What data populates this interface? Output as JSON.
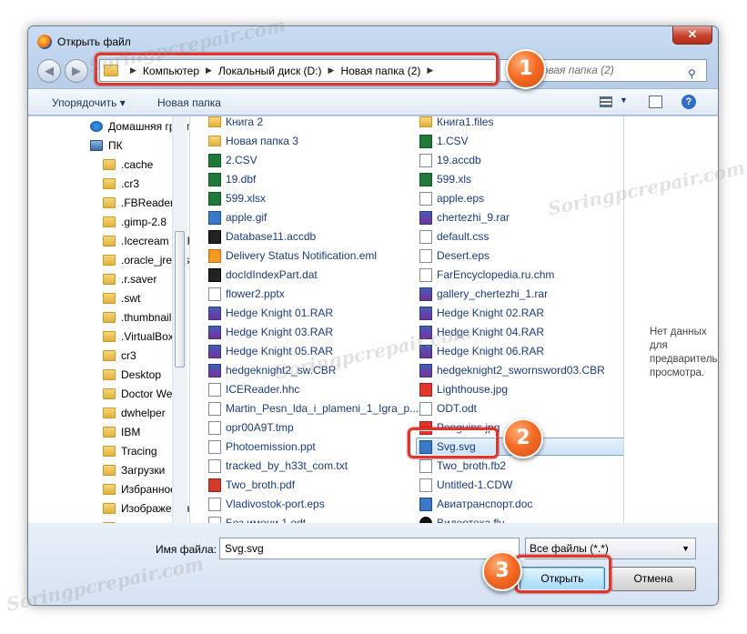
{
  "window": {
    "title": "Открыть файл",
    "close_symbol": "✕"
  },
  "nav": {
    "back": "◀",
    "forward": "▶"
  },
  "address": {
    "parts": [
      "Компьютер",
      "Локальный диск (D:)",
      "Новая папка (2)"
    ]
  },
  "search": {
    "placeholder": "Поиск: Новая папка (2)",
    "text": "иск: Новая папка (2)"
  },
  "toolbar": {
    "organize": "Упорядочить ▾",
    "new_folder": "Новая папка"
  },
  "tree": [
    {
      "label": "Домашняя группа",
      "icon": "homegroup-icon"
    },
    {
      "label": "ПК",
      "icon": "computer-icon"
    },
    {
      "label": ".cache",
      "icon": "folder-icon"
    },
    {
      "label": ".cr3",
      "icon": "folder-icon"
    },
    {
      "label": ".FBReader",
      "icon": "folder-icon"
    },
    {
      "label": ".gimp-2.8",
      "icon": "folder-icon"
    },
    {
      "label": ".Icecream PDF Co",
      "icon": "folder-icon"
    },
    {
      "label": ".oracle_jre_usage",
      "icon": "folder-icon"
    },
    {
      "label": ".r.saver",
      "icon": "folder-icon"
    },
    {
      "label": ".swt",
      "icon": "folder-icon"
    },
    {
      "label": ".thumbnails",
      "icon": "folder-icon"
    },
    {
      "label": ".VirtualBox",
      "icon": "folder-icon"
    },
    {
      "label": "cr3",
      "icon": "folder-icon"
    },
    {
      "label": "Desktop",
      "icon": "folder-icon"
    },
    {
      "label": "Doctor Web",
      "icon": "folder-icon"
    },
    {
      "label": "dwhelper",
      "icon": "folder-icon"
    },
    {
      "label": "IBM",
      "icon": "folder-icon"
    },
    {
      "label": "Tracing",
      "icon": "folder-icon"
    },
    {
      "label": "Загрузки",
      "icon": "downloads-icon"
    },
    {
      "label": "Избранное",
      "icon": "favorites-icon"
    },
    {
      "label": "Изображения",
      "icon": "pictures-icon"
    },
    {
      "label": "Контакты",
      "icon": "contacts-icon"
    }
  ],
  "files_left": [
    {
      "name": "Книга 2",
      "icon": "folder"
    },
    {
      "name": "Новая папка 3",
      "icon": "folder"
    },
    {
      "name": "2.CSV",
      "icon": "excel"
    },
    {
      "name": "19.dbf",
      "icon": "excel"
    },
    {
      "name": "599.xlsx",
      "icon": "excel"
    },
    {
      "name": "apple.gif",
      "icon": "blue"
    },
    {
      "name": "Database11.accdb",
      "icon": "black"
    },
    {
      "name": "Delivery Status Notification.eml",
      "icon": "orange"
    },
    {
      "name": "docIdIndexPart.dat",
      "icon": "black"
    },
    {
      "name": "flower2.pptx",
      "icon": "plain"
    },
    {
      "name": "Hedge Knight 01.RAR",
      "icon": "rar"
    },
    {
      "name": "Hedge Knight 03.RAR",
      "icon": "rar"
    },
    {
      "name": "Hedge Knight 05.RAR",
      "icon": "rar"
    },
    {
      "name": "hedgeknight2_sw.CBR",
      "icon": "rar"
    },
    {
      "name": "ICEReader.hhc",
      "icon": "plain"
    },
    {
      "name": "Martin_Pesn_lda_i_plameni_1_Igra_p...",
      "icon": "plain"
    },
    {
      "name": "opr00A9T.tmp",
      "icon": "plain"
    },
    {
      "name": "Photoemission.ppt",
      "icon": "plain"
    },
    {
      "name": "tracked_by_h33t_com.txt",
      "icon": "plain"
    },
    {
      "name": "Two_broth.pdf",
      "icon": "red"
    },
    {
      "name": "Vladivostok-port.eps",
      "icon": "plain"
    },
    {
      "name": "Без имени 1.odt",
      "icon": "plain"
    }
  ],
  "files_right": [
    {
      "name": "Книга1.files",
      "icon": "folder"
    },
    {
      "name": "1.CSV",
      "icon": "excel"
    },
    {
      "name": "19.accdb",
      "icon": "plain"
    },
    {
      "name": "599.xls",
      "icon": "excel"
    },
    {
      "name": "apple.eps",
      "icon": "plain"
    },
    {
      "name": "chertezhi_9.rar",
      "icon": "rar"
    },
    {
      "name": "default.css",
      "icon": "plain"
    },
    {
      "name": "Desert.eps",
      "icon": "plain"
    },
    {
      "name": "FarEncyclopedia.ru.chm",
      "icon": "plain"
    },
    {
      "name": "gallery_chertezhi_1.rar",
      "icon": "rar"
    },
    {
      "name": "Hedge Knight 02.RAR",
      "icon": "rar"
    },
    {
      "name": "Hedge Knight 04.RAR",
      "icon": "rar"
    },
    {
      "name": "Hedge Knight 06.RAR",
      "icon": "rar"
    },
    {
      "name": "hedgeknight2_swornsword03.CBR",
      "icon": "rar"
    },
    {
      "name": "Lighthouse.jpg",
      "icon": "jpg"
    },
    {
      "name": "ODT.odt",
      "icon": "plain"
    },
    {
      "name": "Penguins.jpg",
      "icon": "jpg"
    },
    {
      "name": "Svg.svg",
      "icon": "blue"
    },
    {
      "name": "Two_broth.fb2",
      "icon": "plain"
    },
    {
      "name": "Untitled-1.CDW",
      "icon": "plain"
    },
    {
      "name": "Авиатранспорт.doc",
      "icon": "blue"
    },
    {
      "name": "Видеотека.flv",
      "icon": "vid"
    }
  ],
  "preview": {
    "text": "Нет данных для предварительного просмотра."
  },
  "bottom": {
    "filename_label": "Имя файла:",
    "filename_value": "Svg.svg",
    "filetype_value": "Все файлы (*.*)",
    "open_button": "Открыть",
    "cancel_button": "Отмена"
  },
  "badges": [
    "1",
    "2",
    "3"
  ],
  "watermark": "Soringpcrepair.com",
  "colors": {
    "highlight": "#e3342c",
    "badge": "#f46d26",
    "link": "#1b3b7a"
  }
}
